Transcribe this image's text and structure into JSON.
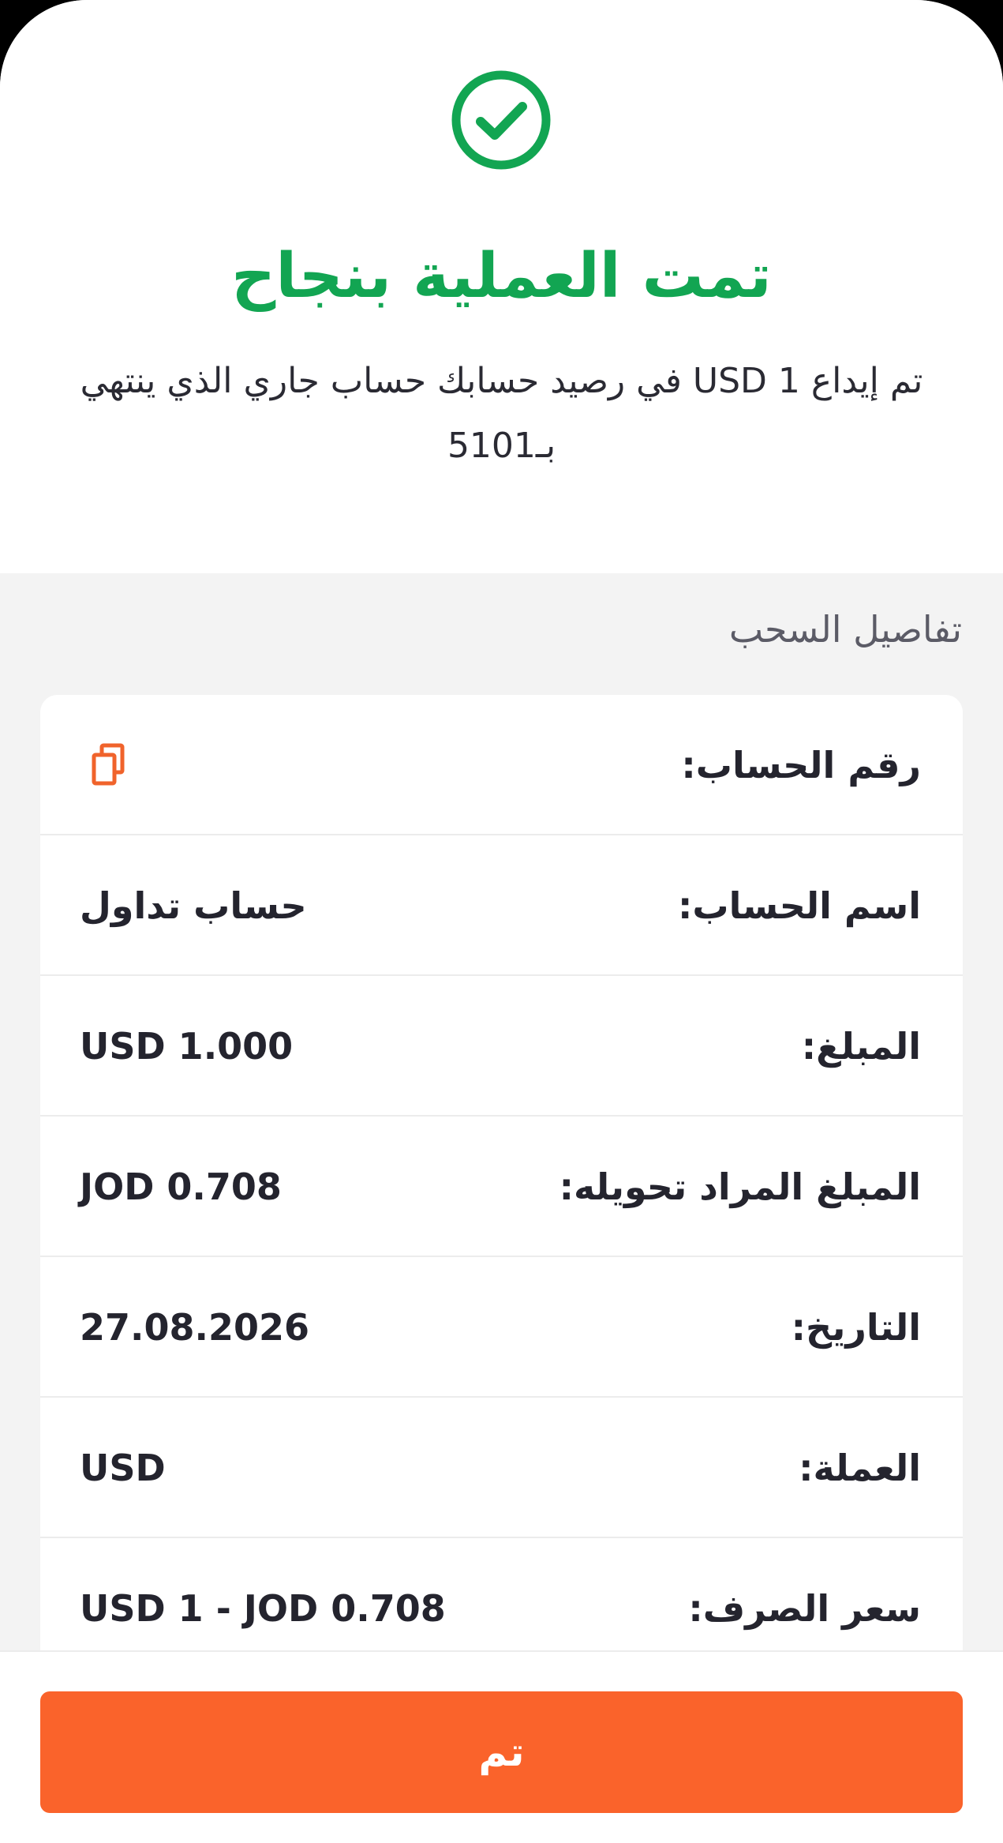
{
  "success": {
    "icon": "check-circle-icon",
    "title": "تمت العملية بنجاح",
    "message": "تم إيداع  USD 1 في رصيد حسابك حساب جاري الذي ينتهي بـ5101"
  },
  "details": {
    "section_title": "تفاصيل السحب",
    "rows": [
      {
        "label": "رقم الحساب:",
        "value": "",
        "icon": "copy-icon"
      },
      {
        "label": "اسم الحساب:",
        "value": "حساب تداول"
      },
      {
        "label": "المبلغ:",
        "value": "USD 1.000"
      },
      {
        "label": "المبلغ المراد تحويله:",
        "value": "JOD 0.708"
      },
      {
        "label": "التاريخ:",
        "value": "27.08.2026"
      },
      {
        "label": "العملة:",
        "value": "USD"
      },
      {
        "label": "سعر الصرف:",
        "value": "USD 1 - JOD 0.708"
      }
    ]
  },
  "footer": {
    "done_label": "تم"
  },
  "colors": {
    "success": "#12a552",
    "accent": "#fa632b",
    "text": "#24242e",
    "background": "#f3f3f3"
  }
}
